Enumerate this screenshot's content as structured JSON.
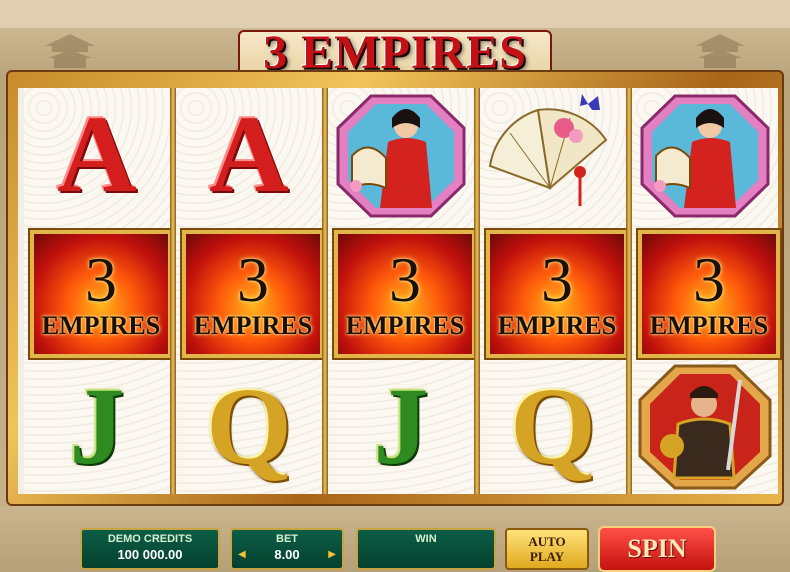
{
  "game": {
    "title": "3 EMPIRES"
  },
  "reels": [
    [
      "A",
      "3 EMPIRES",
      "J"
    ],
    [
      "A",
      "3 EMPIRES",
      "Q"
    ],
    [
      "geisha-icon",
      "3 EMPIRES",
      "J"
    ],
    [
      "fan-icon",
      "3 EMPIRES",
      "Q"
    ],
    [
      "geisha-icon",
      "3 EMPIRES",
      "warrior-icon"
    ]
  ],
  "tile": {
    "number": "3",
    "word": "EMPIRES"
  },
  "controls": {
    "demo_credits_label": "DEMO CREDITS",
    "demo_credits_value": "100 000.00",
    "bet_label": "BET",
    "bet_value": "8.00",
    "win_label": "WIN",
    "win_value": "",
    "autoplay_line1": "AUTO",
    "autoplay_line2": "PLAY",
    "spin_label": "SPIN"
  },
  "colors": {
    "title_red": "#c31116",
    "panel_green": "#0b5e46",
    "gold": "#e2b548",
    "spin_red": "#d41d1d"
  }
}
